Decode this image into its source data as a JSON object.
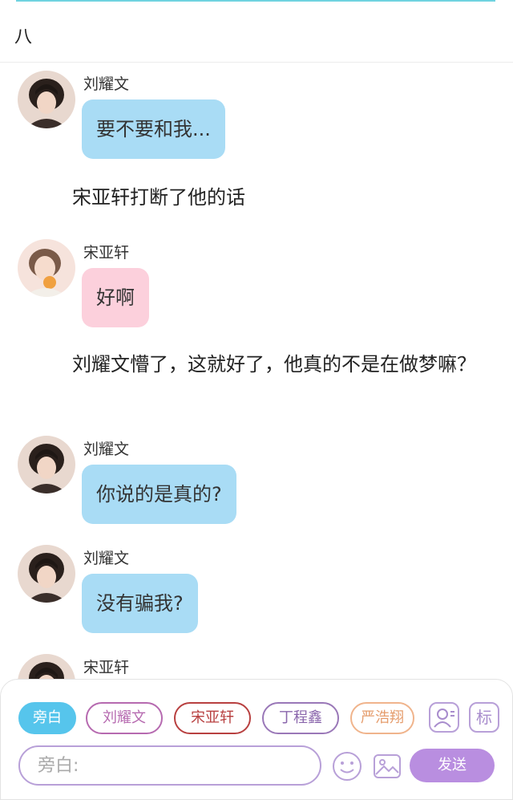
{
  "chapter": {
    "title": "八"
  },
  "messages": [
    {
      "speaker": "刘耀文",
      "text": "要不要和我..."
    },
    {
      "speaker": "宋亚轩",
      "text": "好啊"
    },
    {
      "speaker": "刘耀文",
      "text": "你说的是真的?"
    },
    {
      "speaker": "刘耀文",
      "text": "没有骗我?"
    },
    {
      "speaker": "宋亚轩",
      "text": ""
    }
  ],
  "narrations": [
    "宋亚轩打断了他的话",
    "刘耀文懵了，这就好了，他真的不是在做梦嘛？"
  ],
  "roles": [
    "旁白",
    "刘耀文",
    "宋亚轩",
    "丁程鑫",
    "严浩翔"
  ],
  "tools": {
    "mark_label": "标"
  },
  "input": {
    "placeholder": "旁白:"
  },
  "send_label": "发送",
  "colors": {
    "blue_bubble": "#a9dcf5",
    "pink_bubble": "#fcd0dc",
    "active_role": "#56c5ec",
    "send_button": "#b98ee0",
    "accent_line": "#6fd3e0"
  },
  "icons": [
    "person-card-icon",
    "emoji-icon",
    "image-icon"
  ]
}
